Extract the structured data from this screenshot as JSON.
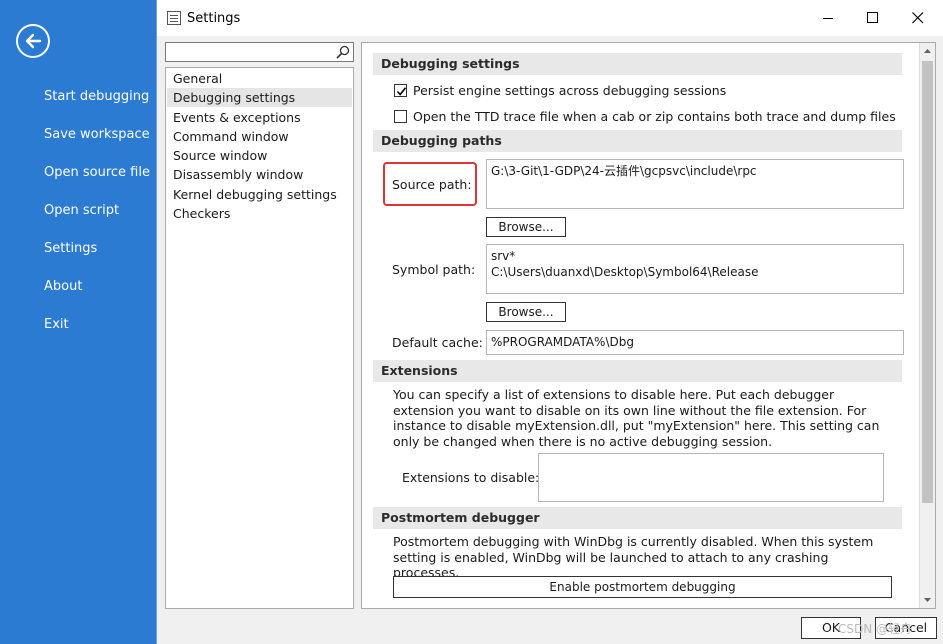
{
  "backstage": {
    "items": [
      {
        "label": "Start debugging"
      },
      {
        "label": "Save workspace"
      },
      {
        "label": "Open source file"
      },
      {
        "label": "Open script"
      },
      {
        "label": "Settings"
      },
      {
        "label": "About"
      },
      {
        "label": "Exit"
      }
    ]
  },
  "dialog": {
    "title": "Settings",
    "search": {
      "value": "",
      "placeholder": ""
    },
    "nav": [
      {
        "label": "General"
      },
      {
        "label": "Debugging settings",
        "selected": true
      },
      {
        "label": "Events & exceptions"
      },
      {
        "label": "Command window"
      },
      {
        "label": "Source window"
      },
      {
        "label": "Disassembly window"
      },
      {
        "label": "Kernel debugging settings"
      },
      {
        "label": "Checkers"
      }
    ],
    "sections": {
      "debugging_settings": {
        "title": "Debugging settings",
        "persist": {
          "label": "Persist engine settings across debugging sessions",
          "checked": true
        },
        "ttd": {
          "label": "Open the TTD trace file when a cab or zip contains both trace and dump files",
          "checked": false
        }
      },
      "debugging_paths": {
        "title": "Debugging paths",
        "source_label": "Source path:",
        "source_value": "G:\\3-Git\\1-GDP\\24-云插件\\gcpsvc\\include\\rpc",
        "browse1": "Browse...",
        "symbol_label": "Symbol path:",
        "symbol_value": "srv*\nC:\\Users\\duanxd\\Desktop\\Symbol64\\Release",
        "browse2": "Browse...",
        "cache_label": "Default cache:",
        "cache_value": "%PROGRAMDATA%\\Dbg"
      },
      "extensions": {
        "title": "Extensions",
        "description": "You can specify a list of extensions to disable here. Put each debugger extension you want to disable on its own line without the file extension. For instance to disable myExtension.dll, put \"myExtension\" here. This setting can only be changed when there is no active debugging session.",
        "disable_label": "Extensions to disable:",
        "disable_value": ""
      },
      "postmortem": {
        "title": "Postmortem debugger",
        "description": "Postmortem debugging with WinDbg is currently disabled. When this system setting is enabled, WinDbg will be launched to attach to any crashing processes.",
        "button": "Enable postmortem debugging"
      }
    },
    "footer": {
      "ok": "OK",
      "cancel": "Cancel"
    },
    "watermark": "CSDN @轻舟"
  },
  "colors": {
    "backstage": "#2b7bd3",
    "highlight": "#d93636"
  },
  "icons": [
    "back-arrow-icon",
    "settings-window-icon",
    "minimize-icon",
    "maximize-icon",
    "close-icon",
    "search-icon",
    "checkmark-icon",
    "scroll-up-icon",
    "scroll-down-icon"
  ]
}
